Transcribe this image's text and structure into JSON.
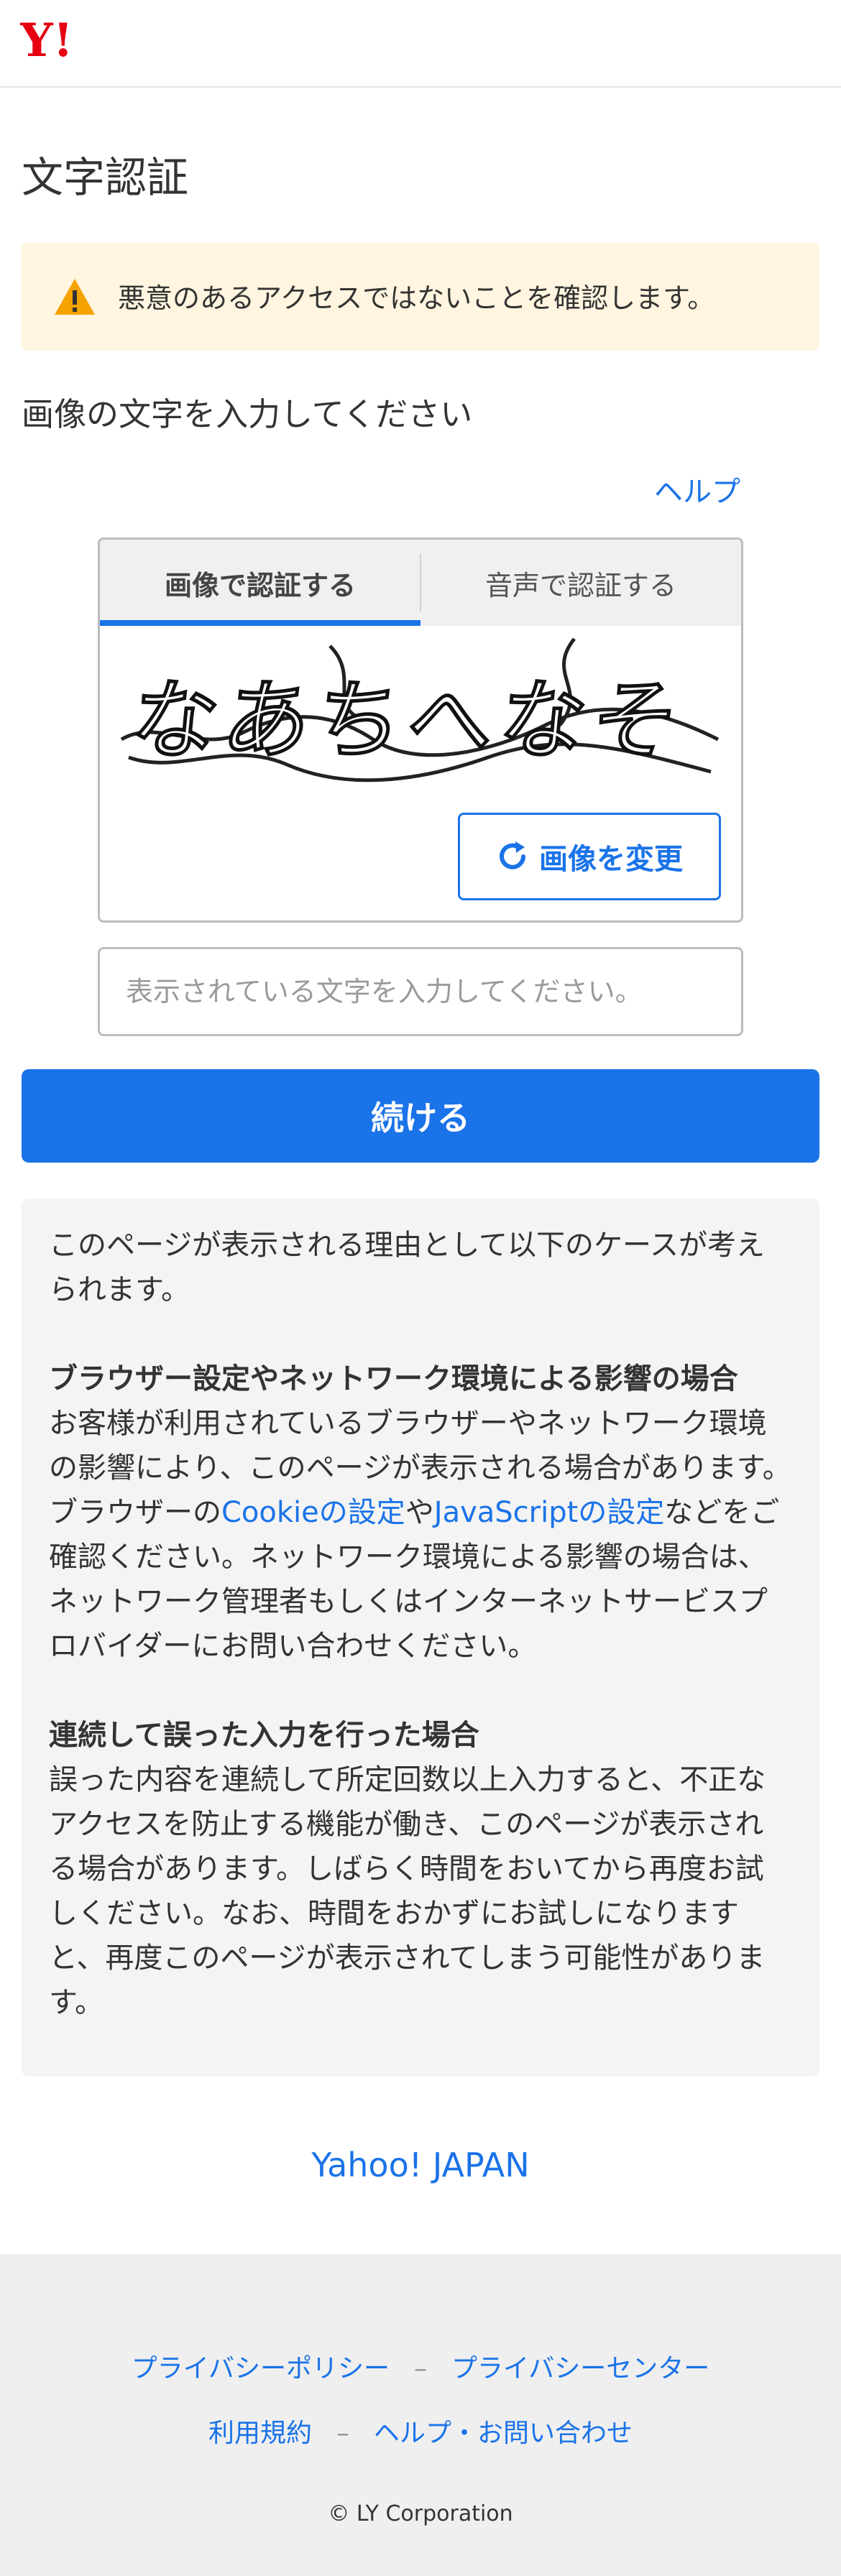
{
  "header": {
    "logo_text": "Y!"
  },
  "page": {
    "title": "文字認証",
    "alert": "悪意のあるアクセスではないことを確認します。",
    "instruction": "画像の文字を入力してください",
    "help": "ヘルプ"
  },
  "captcha": {
    "tab_image": "画像で認証する",
    "tab_audio": "音声で認証する",
    "image_text": "なあちへなそ",
    "change_button": "画像を変更",
    "input_placeholder": "表示されている文字を入力してください。",
    "input_value": ""
  },
  "continue_button": "続ける",
  "info": {
    "intro": "このページが表示される理由として以下のケースが考えられます。",
    "case1_heading": "ブラウザー設定やネットワーク環境による影響の場合",
    "case1_text_a": "お客様が利用されているブラウザーやネットワーク環境の影響により、このページが表示される場合があります。ブラウザーの",
    "cookie_link": "Cookieの設定",
    "case1_text_b": "や",
    "js_link": "JavaScriptの設定",
    "case1_text_c": "などをご確認ください。ネットワーク環境による影響の場合は、ネットワーク管理者もしくはインターネットサービスプロバイダーにお問い合わせください。",
    "case2_heading": "連続して誤った入力を行った場合",
    "case2_text": "誤った内容を連続して所定回数以上入力すると、不正なアクセスを防止する機能が働き、このページが表示される場合があります。しばらく時間をおいてから再度お試しください。なお、時間をおかずにお試しになりますと、再度このページが表示されてしまう可能性があります。"
  },
  "home_link": "Yahoo! JAPAN",
  "footer": {
    "privacy_policy": "プライバシーポリシー",
    "privacy_center": "プライバシーセンター",
    "terms": "利用規約",
    "help_contact": "ヘルプ・お問い合わせ",
    "separator": "–",
    "copyright": "© LY Corporation"
  },
  "colors": {
    "brand_red": "#e60012",
    "link_blue": "#1a73e8",
    "alert_bg": "#fff5e0",
    "warning_orange": "#f5a300"
  }
}
